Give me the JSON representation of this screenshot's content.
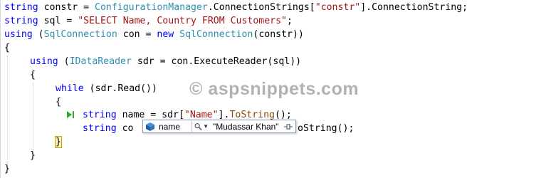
{
  "code": {
    "line1": {
      "kw": "string",
      "var": " constr = ",
      "type": "ConfigurationManager",
      "mid": ".ConnectionStrings[",
      "str": "\"constr\"",
      "end": "].ConnectionString;"
    },
    "line2": {
      "kw": "string",
      "var": " sql = ",
      "str": "\"SELECT Name, Country FROM Customers\"",
      "end": ";"
    },
    "line3": {
      "kw": "using",
      "p1": " (",
      "type1": "SqlConnection",
      "p2": " con = ",
      "kw2": "new",
      "p3": " ",
      "type2": "SqlConnection",
      "end": "(constr))"
    },
    "line4": {
      "brace": "{"
    },
    "line5": {
      "kw": "using",
      "p1": " (",
      "type": "IDataReader",
      "end": " sdr = con.ExecuteReader(sql))"
    },
    "line6": {
      "brace": "{"
    },
    "line7": {
      "kw": "while",
      "end": " (sdr.Read())"
    },
    "line8": {
      "brace": "{"
    },
    "line9": {
      "kw": "string",
      "p1": " name = sdr[",
      "str": "\"Name\"",
      "p2": "].",
      "method": "ToString",
      "end": "();"
    },
    "line10": {
      "kw": "string",
      "p1": " co",
      "tail": "oString();"
    },
    "line11": {
      "brace": "}"
    },
    "line12": {
      "brace": "}"
    },
    "line13": {
      "brace": "}"
    }
  },
  "watermark": "© aspsnippets.com",
  "datatip": {
    "name": "name",
    "value": "\"Mudassar Khan\""
  },
  "icons": {
    "exec": "current-statement-arrow-icon",
    "var": "variable-cube-icon",
    "mag": "magnifier-icon",
    "pin": "pin-icon"
  },
  "colors": {
    "keyword": "#0000ff",
    "type": "#2b91af",
    "string": "#a31515",
    "brace_highlight": "#fff8c0"
  }
}
